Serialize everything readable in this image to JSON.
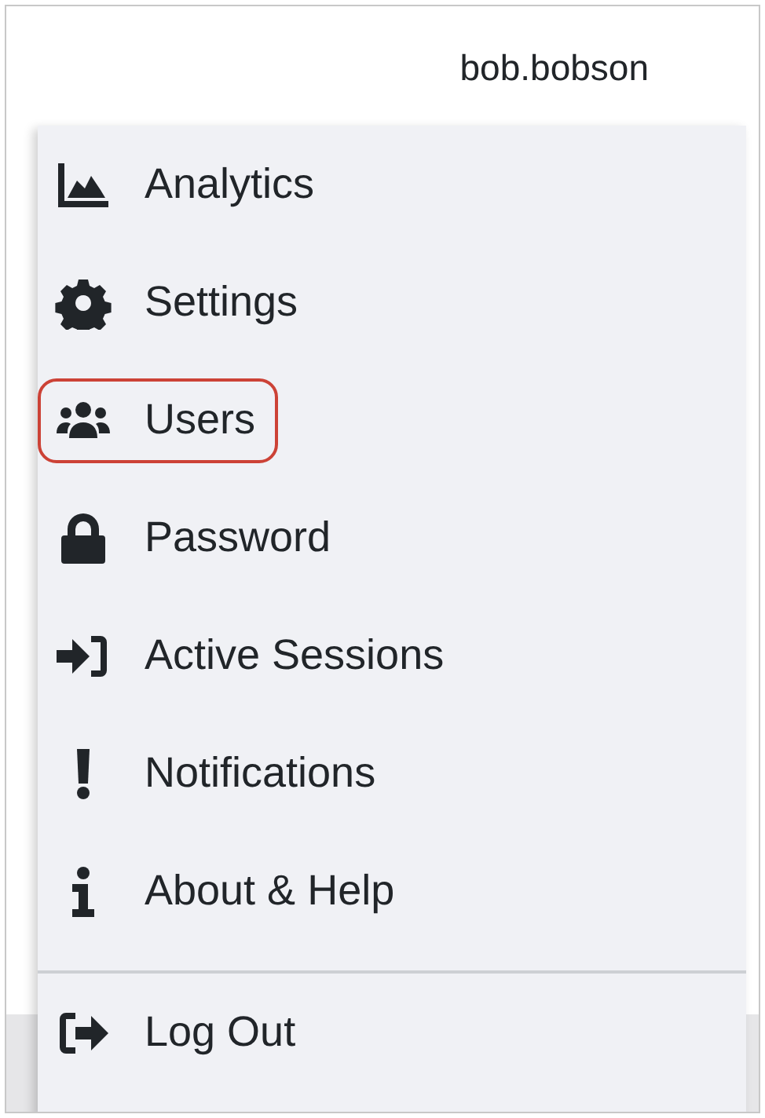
{
  "header": {
    "username": "bob.bobson"
  },
  "menu": {
    "items": [
      {
        "label": "Analytics",
        "highlighted": false
      },
      {
        "label": "Settings",
        "highlighted": false
      },
      {
        "label": "Users",
        "highlighted": true
      },
      {
        "label": "Password",
        "highlighted": false
      },
      {
        "label": "Active Sessions",
        "highlighted": false
      },
      {
        "label": "Notifications",
        "highlighted": false
      },
      {
        "label": "About & Help",
        "highlighted": false
      }
    ],
    "footer_item": {
      "label": "Log Out",
      "highlighted": false
    }
  }
}
